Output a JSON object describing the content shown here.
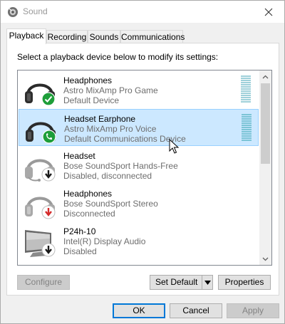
{
  "window": {
    "title": "Sound",
    "icon": "speaker-icon",
    "close_icon": "close-icon"
  },
  "tabs": [
    {
      "label": "Playback",
      "active": true
    },
    {
      "label": "Recording",
      "active": false
    },
    {
      "label": "Sounds",
      "active": false
    },
    {
      "label": "Communications",
      "active": false
    }
  ],
  "playback": {
    "instruction": "Select a playback device below to modify its settings:",
    "devices": [
      {
        "name": "Headphones",
        "line1": "Astro MixAmp Pro Game",
        "line2": "Default Device",
        "icon": "headphones-icon",
        "badge": "green-check-icon",
        "selected": false
      },
      {
        "name": "Headset Earphone",
        "line1": "Astro MixAmp Pro Voice",
        "line2": "Default Communications Device",
        "icon": "headset-icon",
        "badge": "green-phone-icon",
        "selected": true
      },
      {
        "name": "Headset",
        "line1": "Bose SoundSport Hands-Free",
        "line2": "Disabled, disconnected",
        "icon": "headset-icon",
        "badge": "down-arrow-icon",
        "selected": false
      },
      {
        "name": "Headphones",
        "line1": "Bose SoundSport Stereo",
        "line2": "Disconnected",
        "icon": "headphones-icon",
        "badge": "red-down-arrow-icon",
        "selected": false
      },
      {
        "name": "P24h-10",
        "line1": "Intel(R) Display Audio",
        "line2": "Disabled",
        "icon": "monitor-icon",
        "badge": "down-arrow-icon",
        "selected": false
      }
    ],
    "configure_label": "Configure",
    "set_default_label": "Set Default",
    "properties_label": "Properties"
  },
  "dialog_buttons": {
    "ok_label": "OK",
    "cancel_label": "Cancel",
    "apply_label": "Apply"
  },
  "colors": {
    "selection_bg": "#cce8ff",
    "selection_border": "#99d1ff",
    "default_button_border": "#0078d7",
    "badge_green": "#1e9e3a",
    "badge_red": "#d42a2a"
  }
}
